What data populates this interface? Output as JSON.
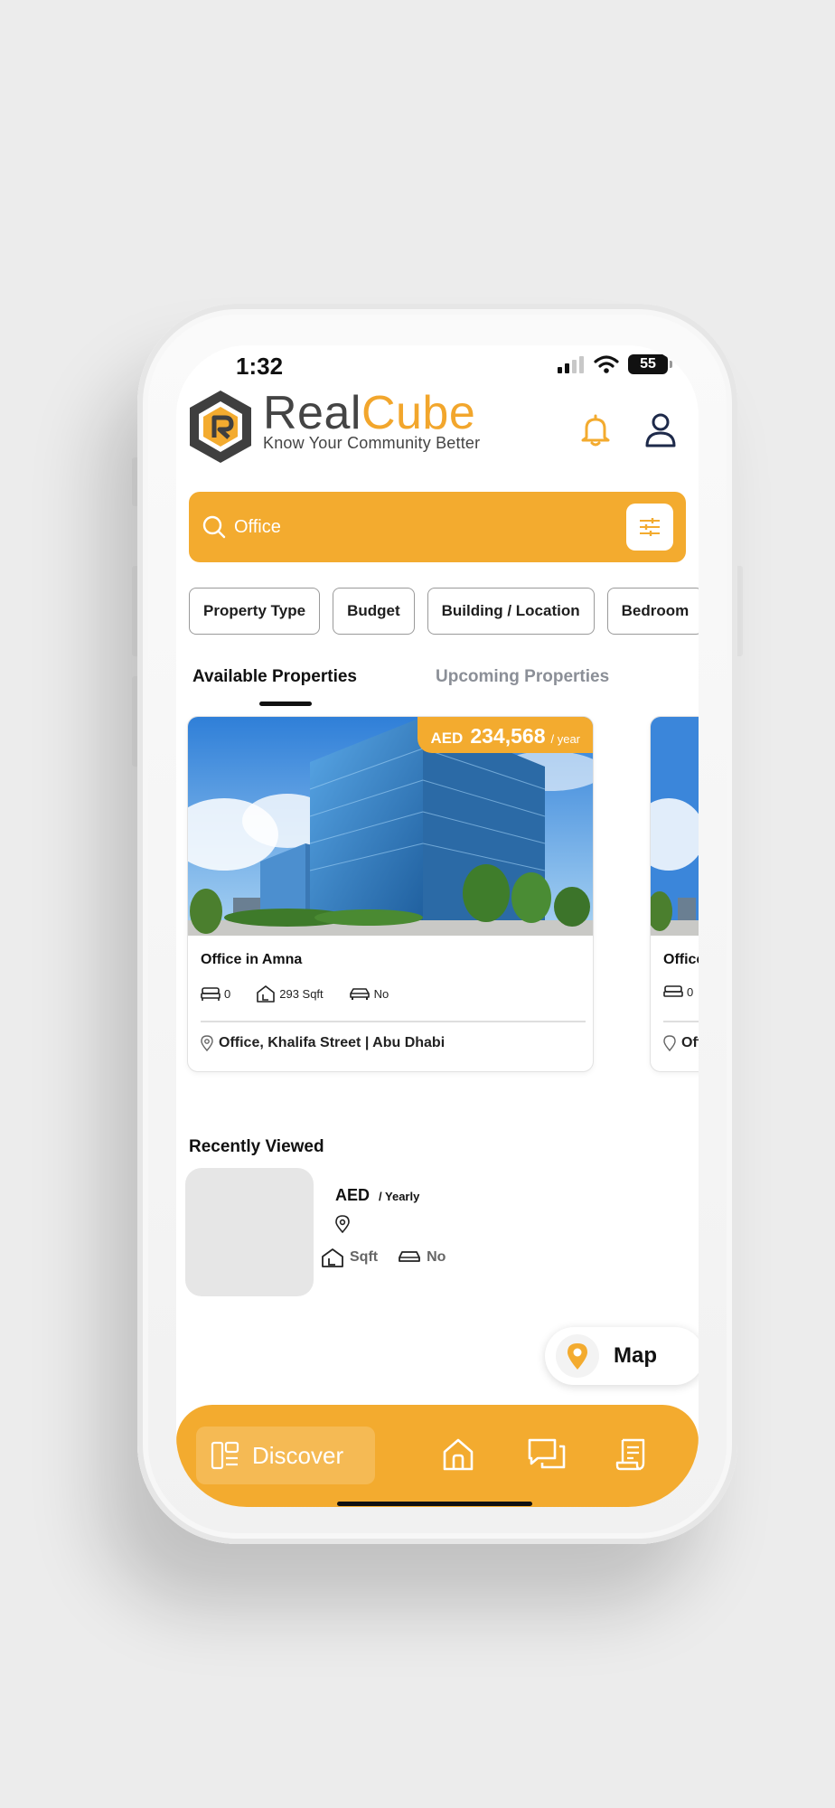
{
  "status_bar": {
    "time": "1:32",
    "battery": "55"
  },
  "header": {
    "brand_part1": "Real",
    "brand_part2": "Cube",
    "tagline": "Know Your Community Better"
  },
  "search": {
    "value": "Office"
  },
  "filters": [
    "Property Type",
    "Budget",
    "Building / Location",
    "Bedroom"
  ],
  "tabs": {
    "active": "Available Properties",
    "inactive": "Upcoming Properties"
  },
  "property": {
    "currency": "AED",
    "price": "234,568",
    "period": "/ year",
    "title": "Office in Amna",
    "bedrooms": "0",
    "area": "293 Sqft",
    "parking": "No",
    "location": "Office, Khalifa Street | Abu Dhabi"
  },
  "property2": {
    "title": "Office in Amna",
    "bedrooms": "0",
    "location": "Office, Khalifa Street | Abu Dhabi"
  },
  "recently_viewed": {
    "title": "Recently Viewed",
    "currency": "AED",
    "period": "/ Yearly",
    "area_unit": "Sqft",
    "parking": "No"
  },
  "map_button": {
    "label": "Map"
  },
  "bottom_nav": {
    "discover": "Discover"
  },
  "colors": {
    "accent": "#f3ab2f",
    "text": "#111111",
    "muted": "#8b8f97"
  }
}
